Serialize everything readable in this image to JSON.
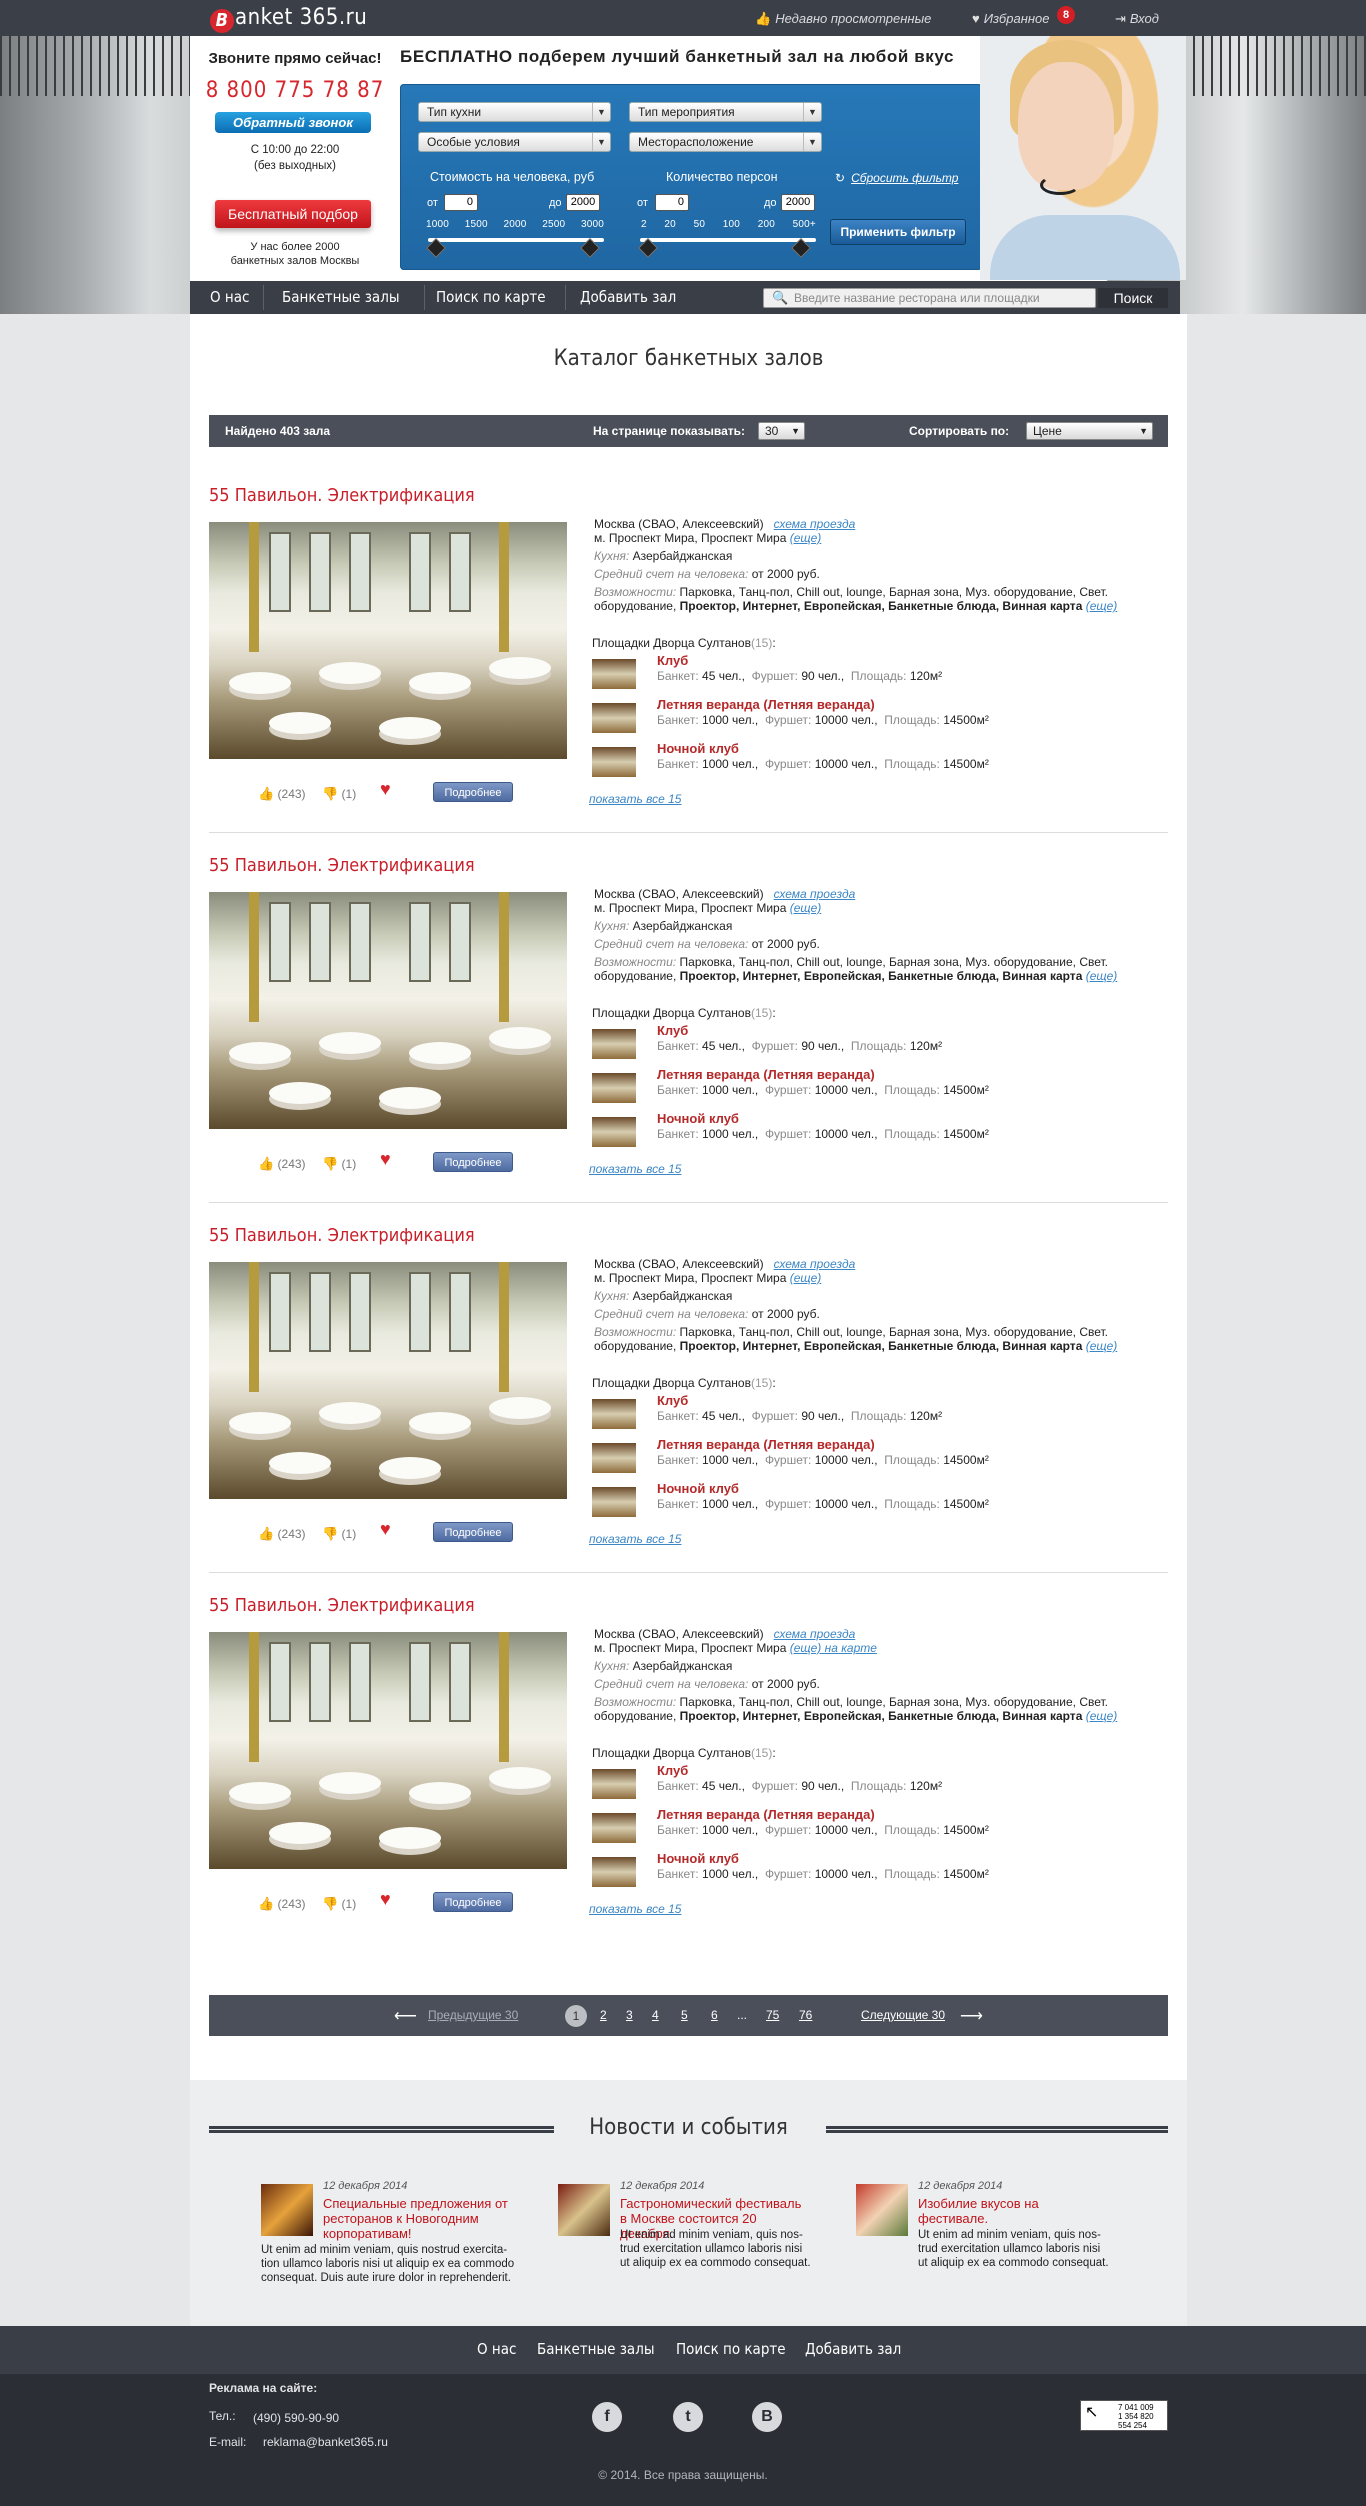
{
  "topbar": {
    "logo_letter": "B",
    "logo_text": "anket 365.ru",
    "recent": "Недавно просмотренные",
    "favorites": "Избранное",
    "favorites_count": "8",
    "login": "Вход"
  },
  "callbox": {
    "heading": "Звоните прямо сейчас!",
    "phone": "8 800 775 78 87",
    "callback": "Обратный звонок",
    "hours_line1": "С 10:00 до 22:00",
    "hours_line2": "(без выходных)",
    "free_pick": "Бесплатный подбор",
    "over_line1": "У нас более 2000",
    "over_line2": "банкетных залов Москвы"
  },
  "filter": {
    "title": "БЕСПЛАТНО подберем лучший банкетный зал на любой вкус",
    "cuisine": "Тип кухни",
    "event": "Тип мероприятия",
    "conditions": "Особые условия",
    "location": "Месторасположение",
    "price_label": "Стоимость на человека, руб",
    "people_label": "Количество персон",
    "from": "от",
    "to": "до",
    "price_from": "0",
    "price_to": "2000",
    "people_from": "0",
    "people_to": "2000",
    "price_ticks": [
      "1000",
      "1500",
      "2000",
      "2500",
      "3000"
    ],
    "people_ticks": [
      "2",
      "20",
      "50",
      "100",
      "200",
      "500+"
    ],
    "reset": "Сбросить фильтр",
    "apply": "Применить фильтр"
  },
  "nav": {
    "items": [
      "О нас",
      "Банкетные залы",
      "Поиск по карте",
      "Добавить зал"
    ],
    "search_placeholder": "Введите название ресторана или площадки",
    "search_button": "Поиск"
  },
  "catalog": {
    "title": "Каталог банкетных залов",
    "found": "Найдено 403 зала",
    "per_page_label": "На странице показывать:",
    "per_page": "30",
    "sort_label": "Сортировать по:",
    "sort": "Цене",
    "cards": [
      {
        "title": "55 Павильон. Электрификация",
        "address": "Москва (СВАО, Алексеевский)",
        "scheme": "схема проезда",
        "metro": "м. Проспект Мира, Проспект Мира",
        "metro_more": "(еще)",
        "cuisine_label": "Кухня:",
        "cuisine": "Азербайджанская",
        "avg_label": "Средний счет на человека:",
        "avg": "от 2000 руб.",
        "feat_label": "Возможности:",
        "feat_plain": "Парковка, Танц-пол, Chill out, lounge, Барная зона, Муз. оборудование, Свет. оборудование,",
        "feat_bold": "Проектор, Интернет, Европейская, Банкетные блюда, Винная карта",
        "feat_more": "(еще)",
        "venues_label": "Площадки Дворца Султанов",
        "venues_count": "(15)",
        "likes": "(243)",
        "dislikes": "(1)",
        "more": "Подробнее",
        "show_all": "показать все 15"
      },
      {
        "title": "55 Павильон. Электрификация",
        "address": "Москва (СВАО, Алексеевский)",
        "scheme": "схема проезда",
        "metro": "м. Проспект Мира, Проспект Мира",
        "metro_more": "(еще)",
        "cuisine_label": "Кухня:",
        "cuisine": "Азербайджанская",
        "avg_label": "Средний счет на человека:",
        "avg": "от 2000 руб.",
        "feat_label": "Возможности:",
        "feat_plain": "Парковка, Танц-пол, Chill out, lounge, Барная зона, Муз. оборудование, Свет. оборудование,",
        "feat_bold": "Проектор, Интернет, Европейская, Банкетные блюда, Винная карта",
        "feat_more": "(еще)",
        "venues_label": "Площадки Дворца Султанов",
        "venues_count": "(15)",
        "likes": "(243)",
        "dislikes": "(1)",
        "more": "Подробнее",
        "show_all": "показать все 15"
      },
      {
        "title": "55 Павильон. Электрификация",
        "address": "Москва (СВАО, Алексеевский)",
        "scheme": "схема проезда",
        "metro": "м. Проспект Мира, Проспект Мира",
        "metro_more": "(еще)",
        "cuisine_label": "Кухня:",
        "cuisine": "Азербайджанская",
        "avg_label": "Средний счет на человека:",
        "avg": "от 2000 руб.",
        "feat_label": "Возможности:",
        "feat_plain": "Парковка, Танц-пол, Chill out, lounge, Барная зона, Муз. оборудование, Свет. оборудование,",
        "feat_bold": "Проектор, Интернет, Европейская, Банкетные блюда, Винная карта",
        "feat_more": "(еще)",
        "venues_label": "Площадки Дворца Султанов",
        "venues_count": "(15)",
        "likes": "(243)",
        "dislikes": "(1)",
        "more": "Подробнее",
        "show_all": "показать все 15"
      },
      {
        "title": "55 Павильон. Электрификация",
        "address": "Москва (СВАО, Алексеевский)",
        "scheme": "схема проезда",
        "metro": "м. Проспект Мира, Проспект Мира",
        "metro_more": "(еще)  на карте",
        "cuisine_label": "Кухня:",
        "cuisine": "Азербайджанская",
        "avg_label": "Средний счет на человека:",
        "avg": "от 2000 руб.",
        "feat_label": "Возможности:",
        "feat_plain": "Парковка, Танц-пол, Chill out, lounge, Барная зона, Муз. оборудование, Свет. оборудование,",
        "feat_bold": "Проектор, Интернет, Европейская, Банкетные блюда, Винная карта",
        "feat_more": "(еще)",
        "venues_label": "Площадки Дворца Султанов",
        "venues_count": "(15)",
        "likes": "(243)",
        "dislikes": "(1)",
        "more": "Подробнее",
        "show_all": "показать все 15"
      }
    ],
    "venues": [
      {
        "name": "Клуб",
        "banquet": "45 чел.",
        "buffet": "90 чел.",
        "area": "120м²"
      },
      {
        "name": "Летняя веранда (Летняя веранда)",
        "banquet": "1000 чел.",
        "buffet": "10000 чел.",
        "area": "14500м²"
      },
      {
        "name": "Ночной клуб",
        "banquet": "1000 чел.",
        "buffet": "10000 чел.",
        "area": "14500м²"
      }
    ],
    "venue_labels": {
      "banquet": "Банкет:",
      "buffet": "Фуршет:",
      "area": "Площадь:"
    }
  },
  "pager": {
    "prev": "Предыдущие 30",
    "pages": [
      "1",
      "2",
      "3",
      "4",
      "5",
      "6",
      "...",
      "75",
      "76"
    ],
    "next": "Следующие 30"
  },
  "news": {
    "title": "Новости и события",
    "items": [
      {
        "date": "12 декабря 2014",
        "headline": "Специальные предложения от ресторанов к Новогодним корпоративам!",
        "text": "Ut enim ad minim veniam, quis nostrud exercita- tion ullamco laboris nisi ut aliquip ex ea commodo consequat. Duis aute irure dolor in reprehenderit."
      },
      {
        "date": "12 декабря 2014",
        "headline": "Гастрономический фестиваль в Москве состоится 20 декабря.",
        "text": "Ut enim ad minim veniam, quis nos- trud exercitation ullamco laboris nisi ut aliquip ex ea commodo consequat."
      },
      {
        "date": "12 декабря 2014",
        "headline": "Изобилие вкусов на фестивале.",
        "text": "Ut enim ad minim veniam, quis nos- trud exercitation ullamco laboris nisi ut aliquip ex ea commodo consequat."
      }
    ]
  },
  "footer": {
    "nav": [
      "О нас",
      "Банкетные залы",
      "Поиск по карте",
      "Добавить зал"
    ],
    "ad_label": "Реклама на сайте:",
    "tel_label": "Тел.:",
    "tel": "(490) 590-90-90",
    "email_label": "E-mail:",
    "email": "reklama@banket365.ru",
    "counter_lines": [
      "7 041 009",
      "1 354 820",
      "554 254"
    ],
    "copyright": "©  2014. Все права защищены."
  },
  "colors": {
    "accent_red": "#c8202a",
    "filter_blue": "#2272b0",
    "dark_bar": "#4a4f59"
  }
}
